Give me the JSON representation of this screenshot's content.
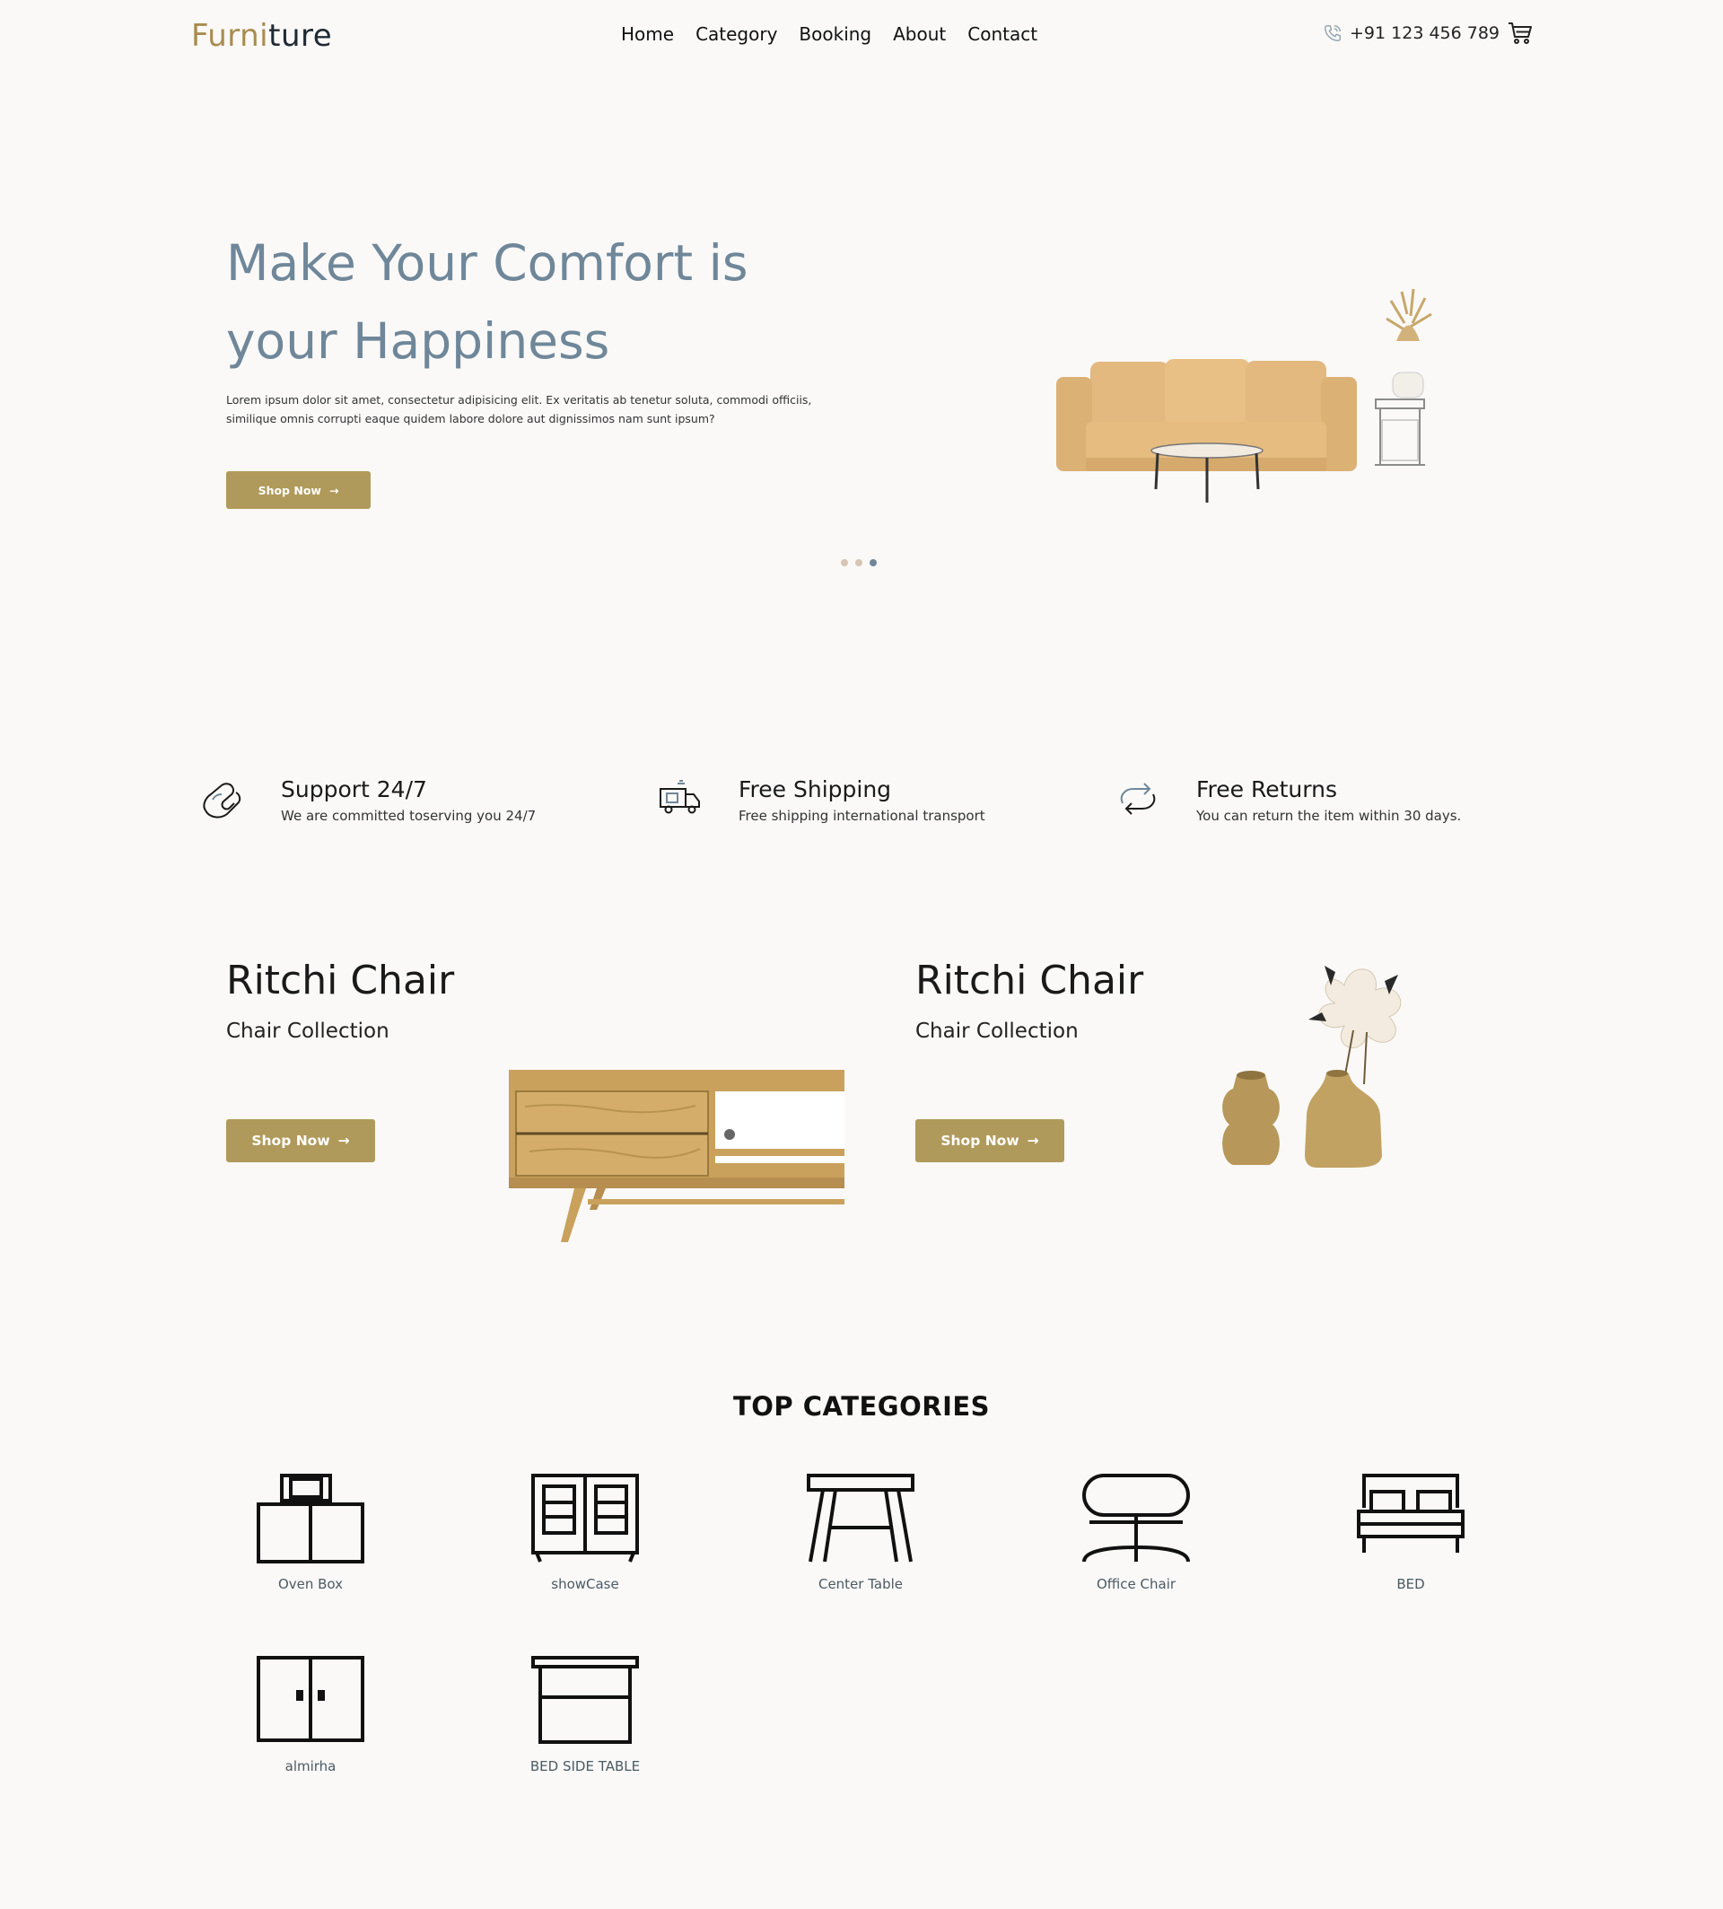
{
  "brand": {
    "part1": "Furni",
    "part2": "ture"
  },
  "nav": {
    "items": [
      "Home",
      "Category",
      "Booking",
      "About",
      "Contact"
    ]
  },
  "header": {
    "phone": "+91 123 456 789"
  },
  "hero": {
    "title_line1": "Make Your Comfort is",
    "title_line2": "your Happiness",
    "description": "Lorem ipsum dolor sit amet, consectetur adipisicing elit. Ex veritatis ab tenetur soluta, commodi officiis, similique omnis corrupti eaque quidem labore dolore aut dignissimos nam sunt ipsum?",
    "button_label": "Shop Now",
    "slides": 3,
    "active_slide": 3
  },
  "features": [
    {
      "icon": "phone-support-icon",
      "title": "Support 24/7",
      "text": "We are committed toserving you 24/7"
    },
    {
      "icon": "delivery-truck-icon",
      "title": "Free Shipping",
      "text": "Free shipping international transport"
    },
    {
      "icon": "return-arrows-icon",
      "title": "Free Returns",
      "text": "You can return the item within 30 days."
    }
  ],
  "promos": [
    {
      "title": "Ritchi Chair",
      "subtitle": "Chair Collection",
      "button_label": "Shop Now"
    },
    {
      "title": "Ritchi Chair",
      "subtitle": "Chair Collection",
      "button_label": "Shop Now"
    }
  ],
  "categories": {
    "heading": "TOP CATEGORIES",
    "items": [
      "Oven Box",
      "showCase",
      "Center Table",
      "Office Chair",
      "BED",
      "almirha",
      "BED SIDE TABLE"
    ]
  },
  "colors": {
    "accent": "#b09a5b",
    "heading_blue": "#6f8799",
    "background": "#faf9f8"
  }
}
